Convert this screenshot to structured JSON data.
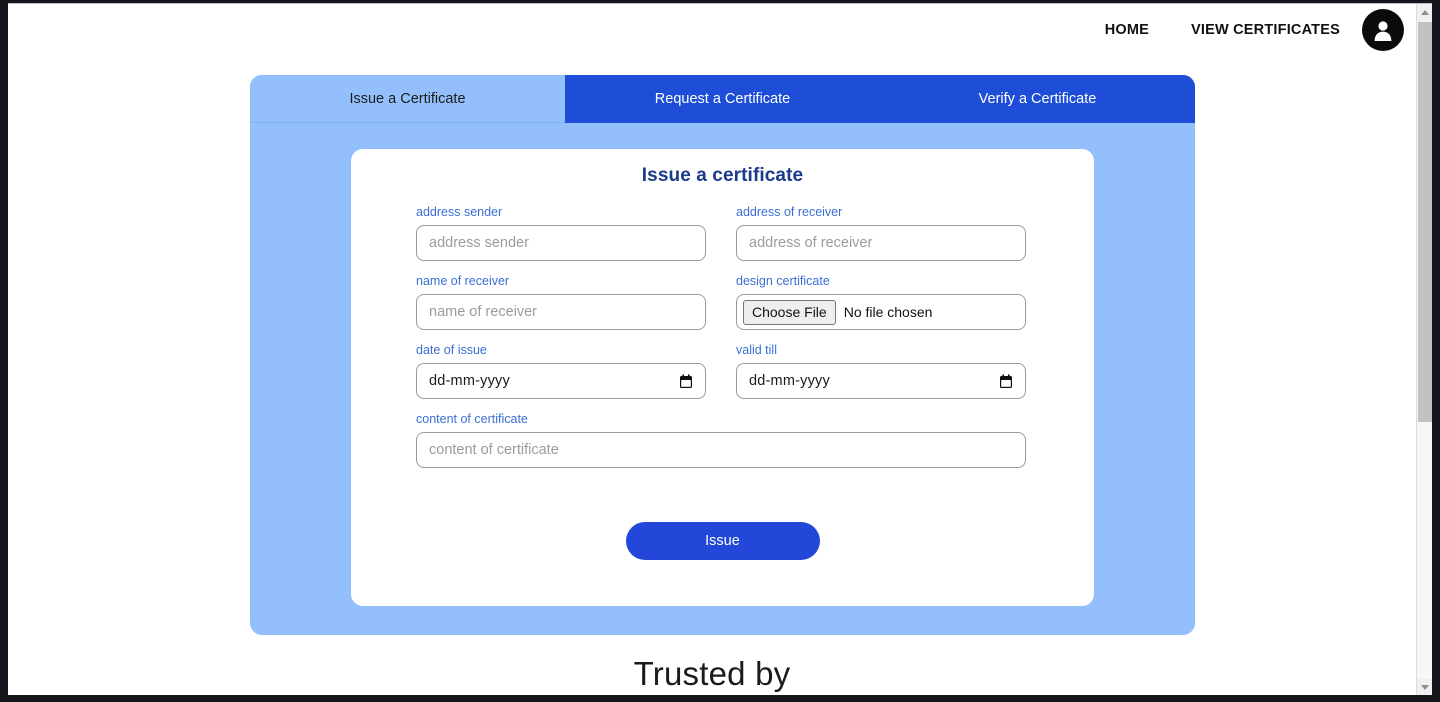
{
  "nav": {
    "links": [
      {
        "label": "HOME",
        "name": "nav-link-home"
      },
      {
        "label": "VIEW CERTIFICATES",
        "name": "nav-link-view-certificates"
      }
    ],
    "avatar_icon": "user-avatar-icon"
  },
  "tabs": [
    {
      "label": "Issue a Certificate",
      "active": true
    },
    {
      "label": "Request a Certificate",
      "active": false
    },
    {
      "label": "Verify a Certificate",
      "active": false
    }
  ],
  "card": {
    "title": "Issue a certificate",
    "fields": {
      "address_sender": {
        "label": "address sender",
        "placeholder": "address sender",
        "value": ""
      },
      "address_receiver": {
        "label": "address of receiver",
        "placeholder": "address of receiver",
        "value": ""
      },
      "name_receiver": {
        "label": "name of receiver",
        "placeholder": "name of receiver",
        "value": ""
      },
      "design_certificate": {
        "label": "design certificate",
        "button_label": "Choose File",
        "file_status": "No file chosen"
      },
      "date_of_issue": {
        "label": "date of issue",
        "value": "dd-mm-yyyy"
      },
      "valid_till": {
        "label": "valid till",
        "value": "dd-mm-yyyy"
      },
      "content_certificate": {
        "label": "content of certificate",
        "placeholder": "content of certificate",
        "value": ""
      }
    },
    "submit_label": "Issue"
  },
  "footer": {
    "trusted_by": "Trusted by"
  },
  "colors": {
    "panel_blue": "#93c0fc",
    "tab_active_blue": "#93c0fc",
    "tab_inactive_blue": "#1e4ed8",
    "title_navy": "#1c3a8b",
    "label_blue": "#3b6fd4",
    "button_blue": "#2347d8",
    "placeholder_gray": "#9b9b9b"
  }
}
